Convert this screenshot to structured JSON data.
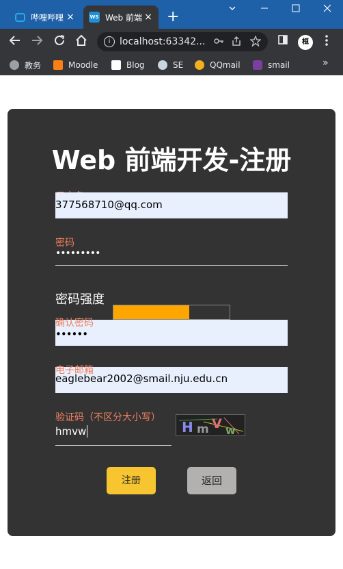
{
  "browser": {
    "tabs": [
      {
        "title": "哔哩哔哩",
        "close": "×"
      },
      {
        "title": "Web 前端",
        "close": "×"
      }
    ],
    "new_tab": "+",
    "address": "localhost:63342...",
    "bookmarks": [
      {
        "label": "教务"
      },
      {
        "label": "Moodle"
      },
      {
        "label": "Blog"
      },
      {
        "label": "SE"
      },
      {
        "label": "QQmail"
      },
      {
        "label": "smail"
      }
    ],
    "avatar_char": "桓",
    "more_label": "»"
  },
  "form": {
    "title": "Web 前端开发-注册",
    "username_label": "用户名",
    "username_value": "377568710@qq.com",
    "password_label": "密码",
    "password_value": "•••••••••",
    "strength_label": "密码强度",
    "strength_level": 0.65,
    "strength_color": "#ffa500",
    "confirm_label": "确认密码",
    "confirm_value": "••••••",
    "email_label": "电子邮箱",
    "email_value": "eaglebear2002@smail.nju.edu.cn",
    "captcha_label": "验证码（不区分大小写）",
    "captcha_value": "hmvw",
    "captcha_letters": [
      "H",
      "m",
      "V",
      "w"
    ],
    "register_button": "注册",
    "back_button": "返回"
  }
}
